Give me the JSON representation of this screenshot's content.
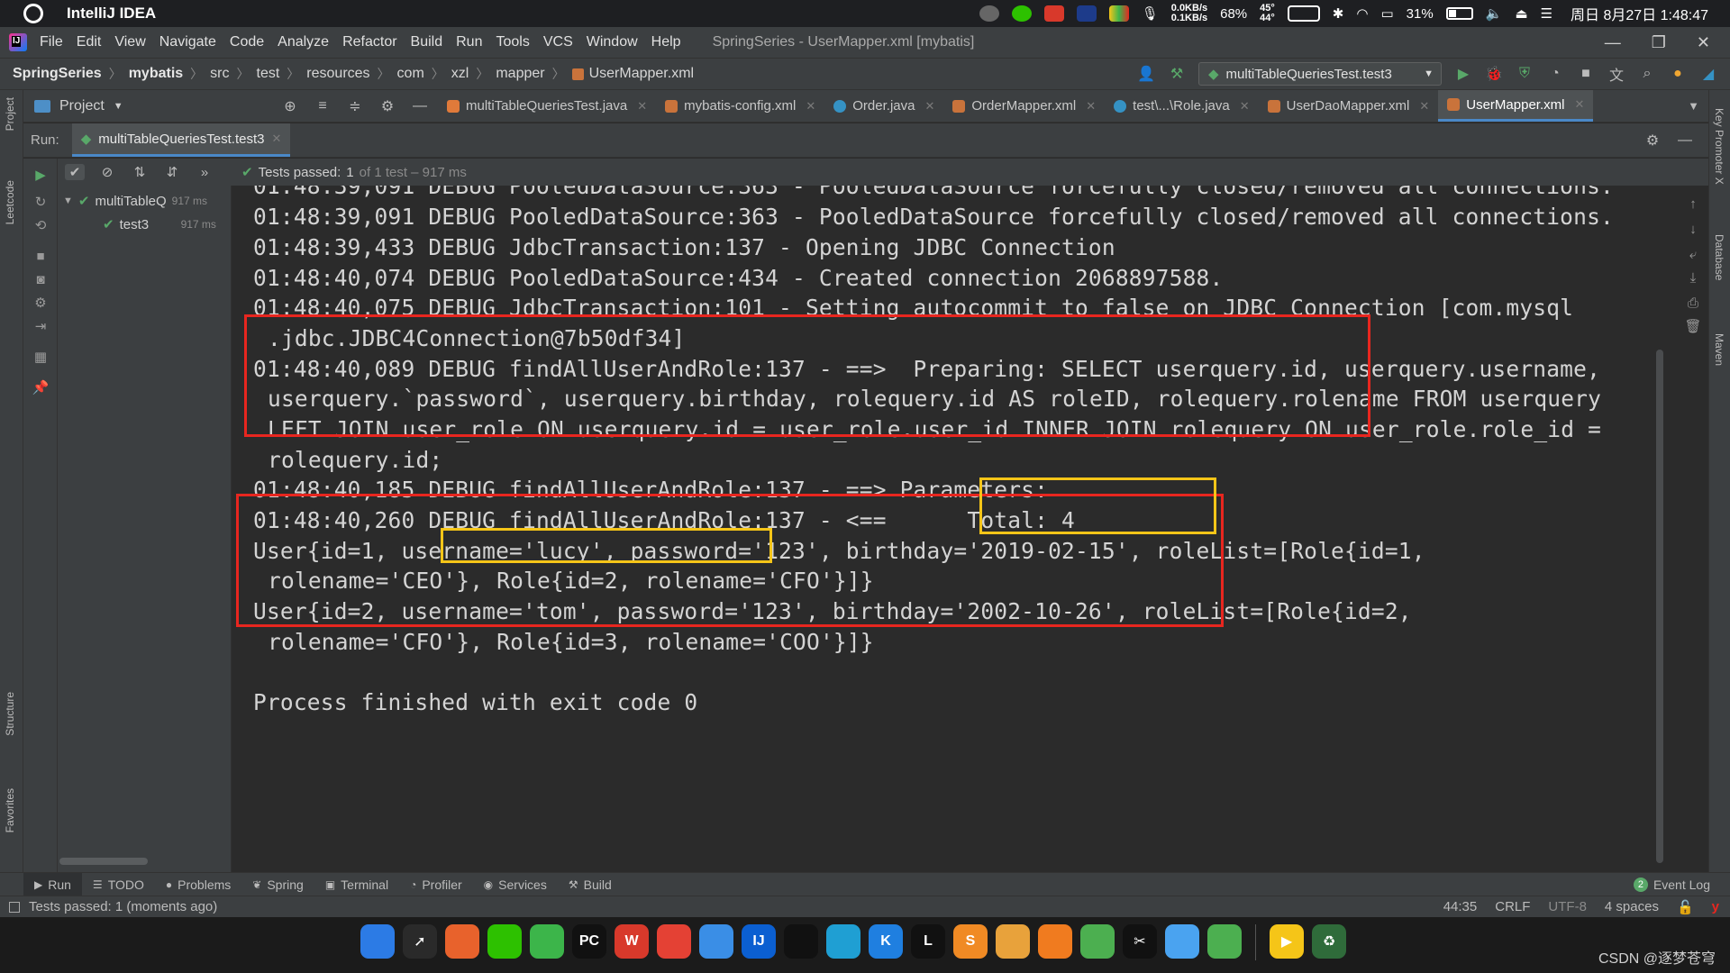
{
  "system_bar": {
    "app_name": "IntelliJ IDEA",
    "net_up": "0.0KB/s",
    "net_down": "0.1KB/s",
    "memory": "68%",
    "temp_1": "45°",
    "temp_2": "44°",
    "battery": "31%",
    "datetime": "周日 8月27日 1:48:47"
  },
  "menu": {
    "items": [
      "File",
      "Edit",
      "View",
      "Navigate",
      "Code",
      "Analyze",
      "Refactor",
      "Build",
      "Run",
      "Tools",
      "VCS",
      "Window",
      "Help"
    ],
    "window_title": "SpringSeries - UserMapper.xml [mybatis]"
  },
  "nav": {
    "crumbs": [
      "SpringSeries",
      "mybatis",
      "src",
      "test",
      "resources",
      "com",
      "xzl",
      "mapper",
      "UserMapper.xml"
    ],
    "run_config": "multiTableQueriesTest.test3"
  },
  "project_panel": {
    "title": "Project"
  },
  "editor_tabs": [
    {
      "label": "multiTableQueriesTest.java",
      "color": "#e07a3a"
    },
    {
      "label": "mybatis-config.xml",
      "color": "#c9733b"
    },
    {
      "label": "Order.java",
      "color": "#3592c4"
    },
    {
      "label": "OrderMapper.xml",
      "color": "#c9733b"
    },
    {
      "label": "test\\...\\Role.java",
      "color": "#3592c4"
    },
    {
      "label": "UserDaoMapper.xml",
      "color": "#c9733b"
    },
    {
      "label": "UserMapper.xml",
      "color": "#c9733b",
      "active": true
    }
  ],
  "run_window": {
    "label": "Run:",
    "tab": "multiTableQueriesTest.test3",
    "status_prefix": "Tests passed:",
    "status_count": "1",
    "status_rest": "of 1 test – 917 ms",
    "tree": [
      {
        "name": "multiTableQ",
        "time": "917 ms"
      },
      {
        "name": "test3",
        "time": "917 ms"
      }
    ]
  },
  "console": {
    "lines": [
      "01:48:39,091 DEBUG PooledDataSource:363 - PooledDataSource forcefully closed/removed all connections.",
      "01:48:39,091 DEBUG PooledDataSource:363 - PooledDataSource forcefully closed/removed all connections.",
      "01:48:39,433 DEBUG JdbcTransaction:137 - Opening JDBC Connection",
      "01:48:40,074 DEBUG PooledDataSource:434 - Created connection 2068897588.",
      "01:48:40,075 DEBUG JdbcTransaction:101 - Setting autocommit to false on JDBC Connection [com.mysql",
      ".jdbc.JDBC4Connection@7b50df34]",
      "01:48:40,089 DEBUG findAllUserAndRole:137 - ==>  Preparing: SELECT userquery.id, userquery.username,",
      "userquery.`password`, userquery.birthday, rolequery.id AS roleID, rolequery.rolename FROM userquery",
      "LEFT JOIN user_role ON userquery.id = user_role.user_id INNER JOIN rolequery ON user_role.role_id =",
      "rolequery.id;",
      "01:48:40,185 DEBUG findAllUserAndRole:137 - ==> Parameters: ",
      "01:48:40,260 DEBUG findAllUserAndRole:137 - <==      Total: 4",
      "User{id=1, username='lucy', password='123', birthday='2019-02-15', roleList=[Role{id=1,",
      "rolename='CEO'}, Role{id=2, rolename='CFO'}]}",
      "User{id=2, username='tom', password='123', birthday='2002-10-26', roleList=[Role{id=2,",
      "rolename='CFO'}, Role{id=3, rolename='COO'}]}",
      "Process finished with exit code 0"
    ]
  },
  "tool_windows": [
    "Run",
    "TODO",
    "Problems",
    "Spring",
    "Terminal",
    "Profiler",
    "Services",
    "Build"
  ],
  "event_log": {
    "label": "Event Log",
    "count": "2"
  },
  "status_bar": {
    "message": "Tests passed: 1 (moments ago)",
    "position": "44:35",
    "line_sep": "CRLF",
    "encoding": "UTF-8",
    "indent": "4 spaces"
  },
  "left_strip": [
    "Project",
    "Leetcode",
    "Structure",
    "Favorites"
  ],
  "right_strip": [
    "Key Promoter X",
    "Database",
    "Maven"
  ],
  "dock": {
    "apps": [
      {
        "name": "Finder",
        "color": "#2c7be5",
        "glyph": ""
      },
      {
        "name": "Launchpad",
        "color": "#2a2a2a",
        "glyph": "➚"
      },
      {
        "name": "Firefox",
        "color": "#e8622c",
        "glyph": ""
      },
      {
        "name": "WeChat",
        "color": "#2dc100",
        "glyph": ""
      },
      {
        "name": "Evernote",
        "color": "#3cb54a",
        "glyph": ""
      },
      {
        "name": "PyCharm",
        "color": "#111111",
        "glyph": "PC"
      },
      {
        "name": "WPS",
        "color": "#d8392b",
        "glyph": "W"
      },
      {
        "name": "Chrome",
        "color": "#e44134",
        "glyph": ""
      },
      {
        "name": "Safari",
        "color": "#3a8ee6",
        "glyph": ""
      },
      {
        "name": "IntelliJ",
        "color": "#0b5fd1",
        "glyph": "IJ"
      },
      {
        "name": "QQ",
        "color": "#111111",
        "glyph": ""
      },
      {
        "name": "Edge",
        "color": "#1f9fd3",
        "glyph": ""
      },
      {
        "name": "Klack",
        "color": "#1f7fe0",
        "glyph": "K"
      },
      {
        "name": "L",
        "color": "#111111",
        "glyph": "L"
      },
      {
        "name": "Sublime",
        "color": "#f08a24",
        "glyph": "S"
      },
      {
        "name": "Office",
        "color": "#e8a23b",
        "glyph": ""
      },
      {
        "name": "Search",
        "color": "#f07b1f",
        "glyph": ""
      },
      {
        "name": "Maps",
        "color": "#4caf50",
        "glyph": ""
      },
      {
        "name": "CapCut",
        "color": "#111111",
        "glyph": "✂"
      },
      {
        "name": "Folder",
        "color": "#4aa3f0",
        "glyph": ""
      },
      {
        "name": "Frog",
        "color": "#4caf50",
        "glyph": ""
      },
      {
        "name": "Player",
        "color": "#f5c518",
        "glyph": "▶"
      },
      {
        "name": "Recycle",
        "color": "#2f6b3a",
        "glyph": "♻"
      }
    ],
    "watermark": "CSDN @逐梦苍穹"
  }
}
